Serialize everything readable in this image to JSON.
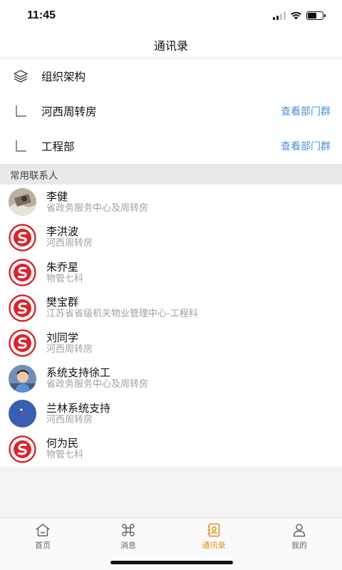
{
  "status_bar": {
    "time": "11:45"
  },
  "header": {
    "title": "通讯录"
  },
  "org": {
    "items": [
      {
        "label": "组织架构",
        "action": "",
        "icon": "layers-icon"
      },
      {
        "label": "河西周转房",
        "action": "查看部门群",
        "icon": "branch-corner-icon"
      },
      {
        "label": "工程部",
        "action": "查看部门群",
        "icon": "branch-corner-icon"
      }
    ]
  },
  "contacts_section": {
    "title": "常用联系人"
  },
  "contacts": [
    {
      "name": "李健",
      "dept": "省政务服务中心及周转房",
      "avatar": "photo-avatar"
    },
    {
      "name": "李洪波",
      "dept": "河西周转房",
      "avatar": "logo-avatar"
    },
    {
      "name": "朱乔星",
      "dept": "物管七科",
      "avatar": "logo-avatar"
    },
    {
      "name": "樊宝群",
      "dept": "江苏省省级机关物业管理中心-工程科",
      "avatar": "logo-avatar"
    },
    {
      "name": "刘同学",
      "dept": "河西周转房",
      "avatar": "logo-avatar"
    },
    {
      "name": "系统支持徐工",
      "dept": "省政务服务中心及周转房",
      "avatar": "photo-avatar"
    },
    {
      "name": "兰林系统支持",
      "dept": "河西周转房",
      "avatar": "photo-avatar"
    },
    {
      "name": "何为民",
      "dept": "物管七科",
      "avatar": "logo-avatar"
    }
  ],
  "tabbar": {
    "tabs": [
      {
        "label": "首页",
        "icon": "home-icon"
      },
      {
        "label": "消息",
        "icon": "command-icon"
      },
      {
        "label": "通讯录",
        "icon": "contacts-book-icon",
        "active": true
      },
      {
        "label": "我的",
        "icon": "person-icon"
      }
    ]
  },
  "colors": {
    "accent_link": "#4a8fd8",
    "tab_active": "#e08a1e",
    "logo_red": "#d7262e"
  }
}
